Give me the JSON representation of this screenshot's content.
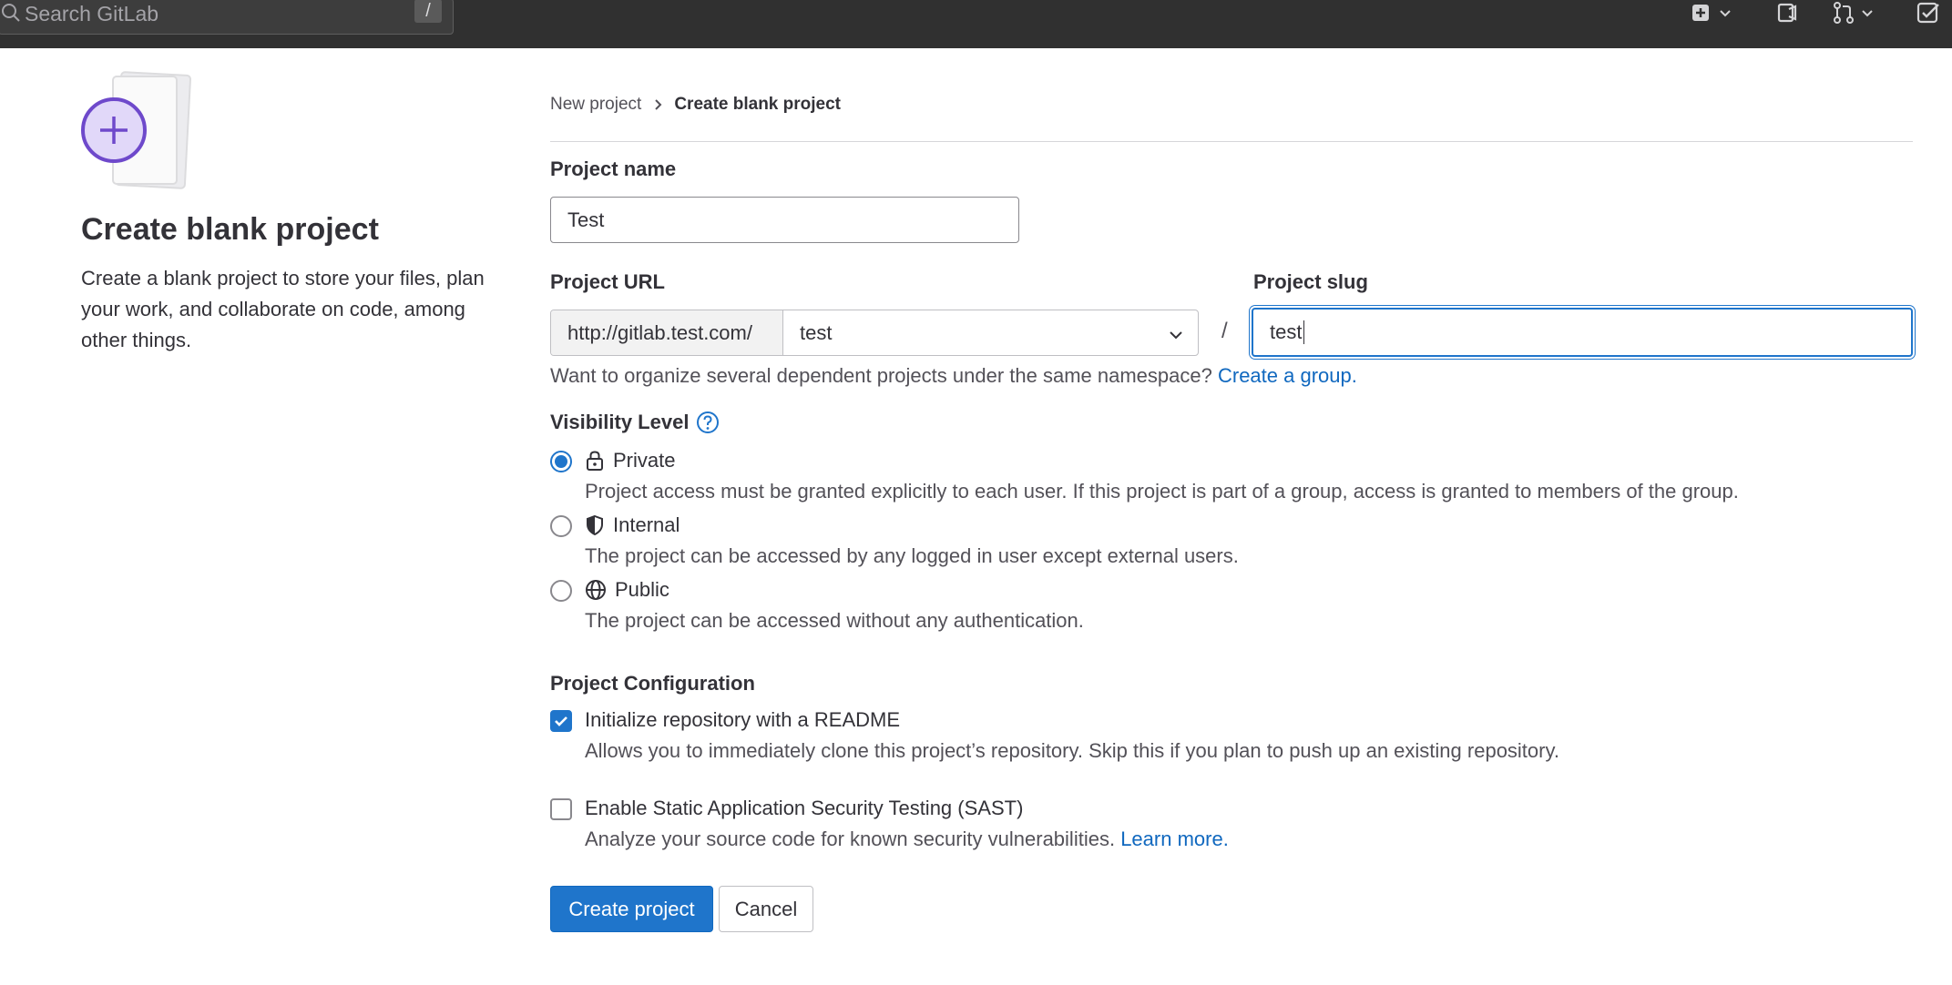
{
  "topbar": {
    "search_placeholder": "Search GitLab",
    "search_shortcut": "/",
    "icons": [
      "search-icon",
      "plus-square-icon",
      "chevron-down-icon",
      "issues-icon",
      "merge-request-icon",
      "todo-icon"
    ]
  },
  "left": {
    "title": "Create blank project",
    "description": "Create a blank project to store your files, plan your work, and collaborate on code, among other things."
  },
  "breadcrumb": {
    "parent": "New project",
    "current": "Create blank project"
  },
  "form": {
    "project_name_label": "Project name",
    "project_name_value": "Test",
    "project_url_label": "Project URL",
    "url_prefix": "http://gitlab.test.com/",
    "namespace_value": "test",
    "separator": "/",
    "project_slug_label": "Project slug",
    "project_slug_value": "test",
    "namespace_help": "Want to organize several dependent projects under the same namespace?",
    "namespace_help_link": "Create a group."
  },
  "visibility": {
    "title": "Visibility Level",
    "options": [
      {
        "label": "Private",
        "icon": "lock-icon",
        "checked": true,
        "description": "Project access must be granted explicitly to each user. If this project is part of a group, access is granted to members of the group."
      },
      {
        "label": "Internal",
        "icon": "shield-icon",
        "checked": false,
        "description": "The project can be accessed by any logged in user except external users."
      },
      {
        "label": "Public",
        "icon": "globe-icon",
        "checked": false,
        "description": "The project can be accessed without any authentication."
      }
    ]
  },
  "config": {
    "title": "Project Configuration",
    "readme_label": "Initialize repository with a README",
    "readme_checked": true,
    "readme_desc": "Allows you to immediately clone this project’s repository. Skip this if you plan to push up an existing repository.",
    "sast_label": "Enable Static Application Security Testing (SAST)",
    "sast_checked": false,
    "sast_desc": "Analyze your source code for known security vulnerabilities.",
    "sast_link": "Learn more."
  },
  "actions": {
    "create": "Create project",
    "cancel": "Cancel"
  },
  "colors": {
    "topbar": "#303030",
    "primary": "#1f75cb",
    "link": "#1068bf",
    "accent_purple": "#6e49cb"
  }
}
